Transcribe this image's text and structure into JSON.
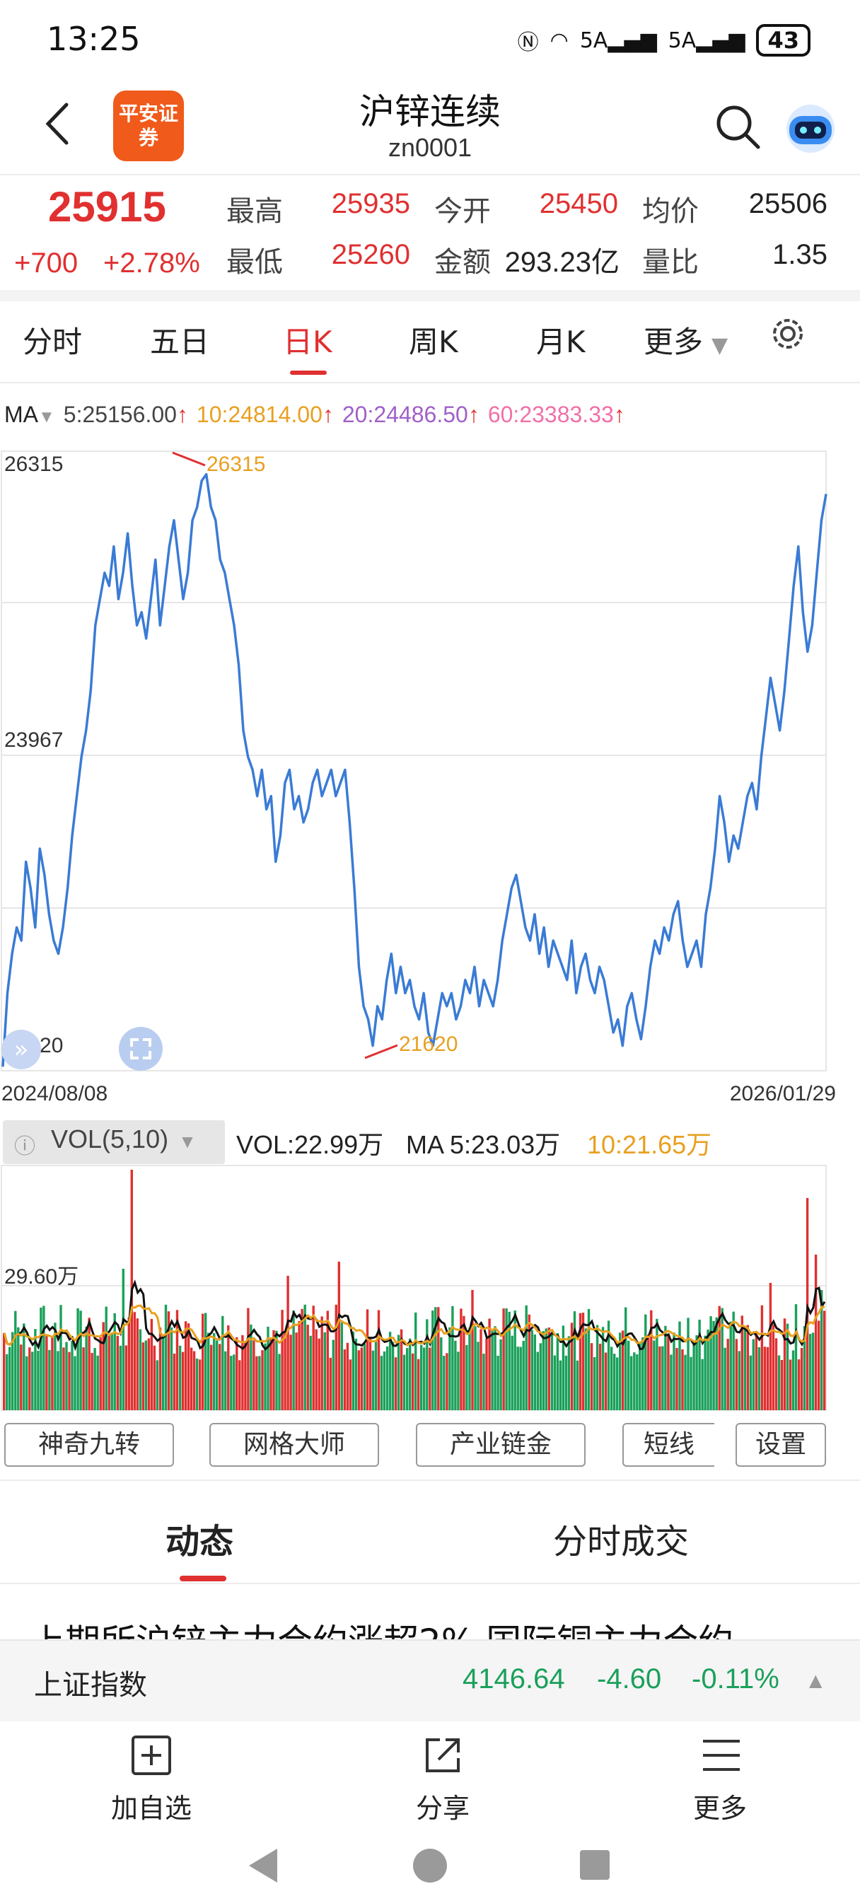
{
  "status_bar": {
    "time": "13:25",
    "network1": "5A",
    "network2": "5A",
    "battery": "43"
  },
  "header": {
    "logo_text": "平安证券",
    "title": "沪锌连续",
    "code": "zn0001"
  },
  "quote": {
    "price": "25915",
    "change": "+700",
    "change_pct": "+2.78%",
    "high_label": "最高",
    "high": "25935",
    "open_label": "今开",
    "open": "25450",
    "avg_label": "均价",
    "avg": "25506",
    "low_label": "最低",
    "low": "25260",
    "amount_label": "金额",
    "amount": "293.23亿",
    "vol_ratio_label": "量比",
    "vol_ratio": "1.35"
  },
  "tabs": [
    "分时",
    "五日",
    "日K",
    "周K",
    "月K",
    "更多"
  ],
  "ma": {
    "label": "MA",
    "ma5": "5:25156.00",
    "ma10": "10:24814.00",
    "ma20": "20:24486.50",
    "ma60": "60:23383.33"
  },
  "price_chart": {
    "y_top": "26315",
    "y_mid": "23967",
    "y_bottom": "21620",
    "max_marker": "26315",
    "min_marker": "21620",
    "date_start": "2024/08/08",
    "date_end": "2026/01/29"
  },
  "volume": {
    "indicator": "VOL(5,10)",
    "vol": "VOL:22.99万",
    "ma5": "MA 5:23.03万",
    "ma10": "10:21.65万",
    "y_label": "29.60万"
  },
  "tools": [
    "神奇九转",
    "网格大师",
    "产业链金",
    "短线",
    "设置"
  ],
  "news_tabs": [
    "动态",
    "分时成交"
  ],
  "headline": "上期所沪锌主力合约涨超2% 国际铜主力合约",
  "index": {
    "name": "上证指数",
    "value": "4146.64",
    "change": "-4.60",
    "pct": "-0.11%"
  },
  "bottom_bar": {
    "watchlist": "加自选",
    "share": "分享",
    "more": "更多"
  },
  "colors": {
    "up": "#e03030",
    "down": "#1aa05a",
    "line": "#3a7bd5",
    "ma10": "#e8a020",
    "ma20": "#a060c8",
    "ma60": "#f070a8"
  },
  "chart_data": {
    "type": "line",
    "title": "",
    "x_start": "2024/08/08",
    "x_end": "2026/01/29",
    "ylim": [
      21620,
      26315
    ],
    "series": [
      {
        "values": [
          21640,
          22200,
          22500,
          22700,
          22600,
          23200,
          23000,
          22700,
          23300,
          23100,
          22800,
          22600,
          22500,
          22700,
          23000,
          23400,
          23700,
          24000,
          24200,
          24500,
          25000,
          25200,
          25400,
          25300,
          25600,
          25200,
          25400,
          25700,
          25300,
          25000,
          25100,
          24900,
          25200,
          25500,
          25000,
          25300,
          25600,
          25800,
          25500,
          25200,
          25400,
          25800,
          25900,
          26100,
          26150,
          25900,
          25800,
          25500,
          25400,
          25200,
          25000,
          24700,
          24200,
          24000,
          23900,
          23700,
          23900,
          23600,
          23700,
          23200,
          23400,
          23800,
          23900,
          23600,
          23700,
          23500,
          23600,
          23800,
          23900,
          23700,
          23800,
          23900,
          23700,
          23800,
          23900,
          23500,
          23000,
          22400,
          22100,
          22000,
          21800,
          22100,
          22000,
          22300,
          22500,
          22200,
          22400,
          22200,
          22300,
          22100,
          22000,
          22200,
          21900,
          21800,
          22000,
          22200,
          22100,
          22200,
          22000,
          22100,
          22300,
          22200,
          22400,
          22100,
          22300,
          22200,
          22100,
          22300,
          22600,
          22800,
          23000,
          23100,
          22900,
          22700,
          22600,
          22800,
          22500,
          22700,
          22400,
          22600,
          22500,
          22400,
          22300,
          22600,
          22200,
          22400,
          22500,
          22300,
          22200,
          22400,
          22300,
          22100,
          21900,
          22000,
          21800,
          22100,
          22200,
          22000,
          21850,
          22100,
          22400,
          22600,
          22500,
          22700,
          22600,
          22800,
          22900,
          22600,
          22400,
          22500,
          22600,
          22400,
          22800,
          23000,
          23300,
          23700,
          23500,
          23200,
          23400,
          23300,
          23500,
          23700,
          23800,
          23600,
          24000,
          24300,
          24600,
          24400,
          24200,
          24500,
          24900,
          25300,
          25600,
          25100,
          24800,
          25000,
          25400,
          25800,
          26000
        ]
      }
    ],
    "volume": {
      "y_label_value": 29.6,
      "unit": "万"
    }
  }
}
